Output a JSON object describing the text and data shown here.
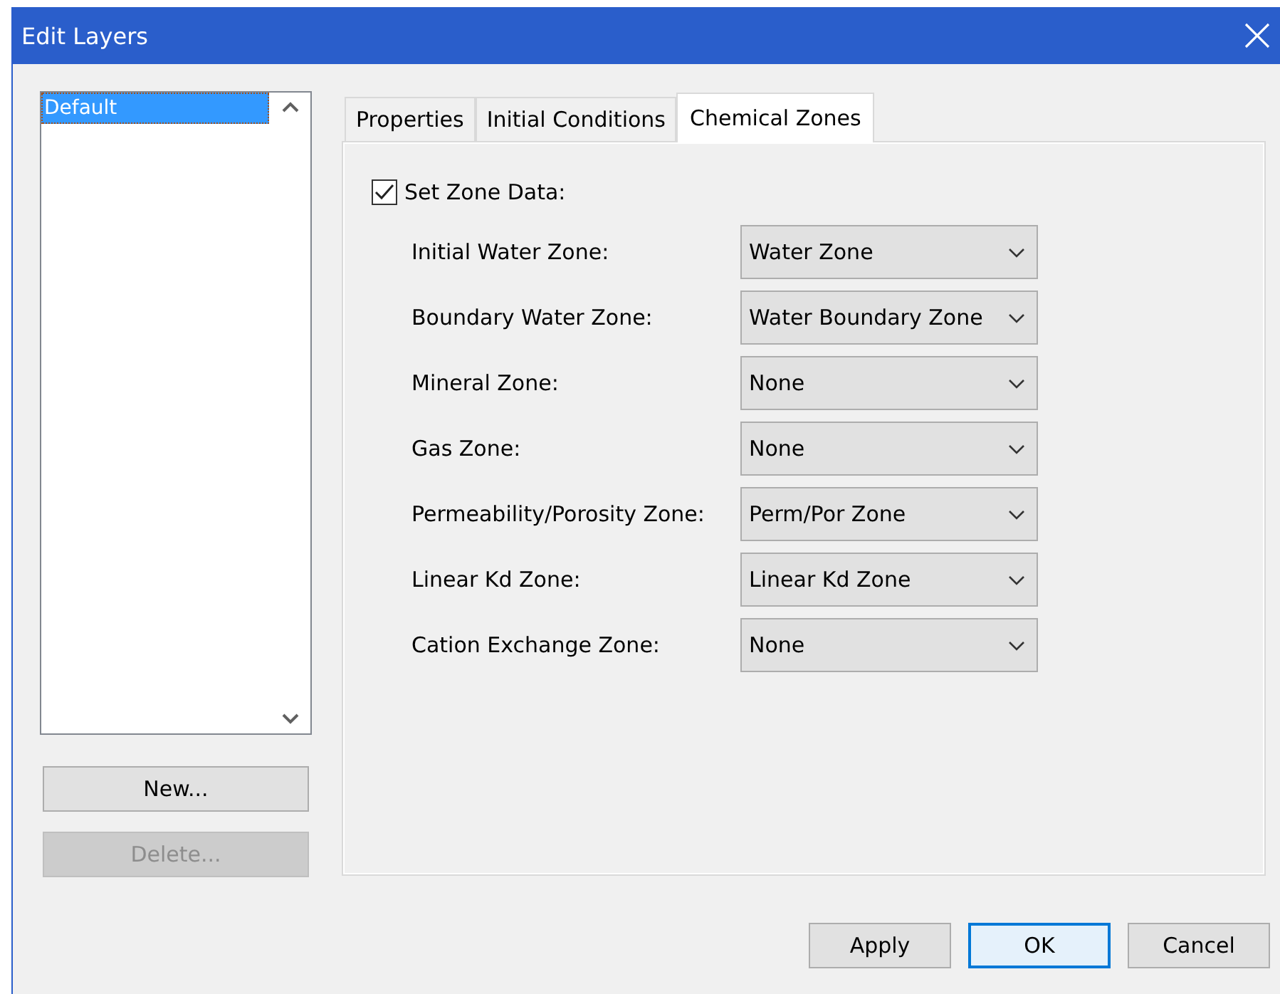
{
  "window": {
    "title": "Edit Layers"
  },
  "layers": [
    {
      "label": "Default",
      "selected": true
    }
  ],
  "layer_buttons": [
    {
      "label": "New...",
      "disabled": false
    },
    {
      "label": "Delete...",
      "disabled": true
    }
  ],
  "tabs": [
    {
      "label": "Properties",
      "selected": false
    },
    {
      "label": "Initial Conditions",
      "selected": false
    },
    {
      "label": "Chemical Zones",
      "selected": true
    }
  ],
  "set_zone_data": {
    "label": "Set Zone Data:",
    "checked": true
  },
  "zones": [
    {
      "label": "Initial Water Zone:",
      "value": "Water Zone"
    },
    {
      "label": "Boundary Water Zone:",
      "value": "Water Boundary Zone"
    },
    {
      "label": "Mineral Zone:",
      "value": "None"
    },
    {
      "label": "Gas Zone:",
      "value": "None"
    },
    {
      "label": "Permeability/Porosity Zone:",
      "value": "Perm/Por Zone"
    },
    {
      "label": "Linear Kd Zone:",
      "value": "Linear Kd Zone"
    },
    {
      "label": "Cation Exchange Zone:",
      "value": "None"
    }
  ],
  "buttons": [
    {
      "label": "Apply",
      "default": false
    },
    {
      "label": "OK",
      "default": true
    },
    {
      "label": "Cancel",
      "default": false
    }
  ]
}
